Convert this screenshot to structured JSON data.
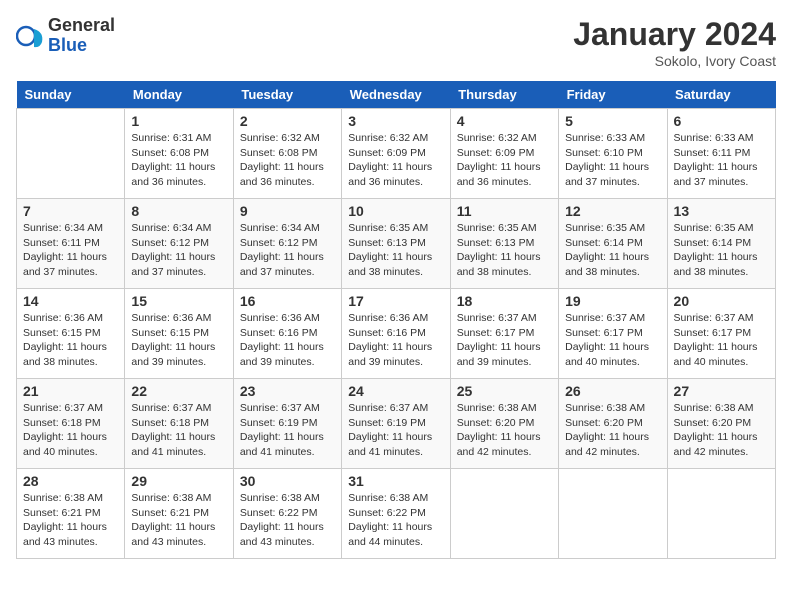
{
  "logo": {
    "general": "General",
    "blue": "Blue"
  },
  "title": "January 2024",
  "subtitle": "Sokolo, Ivory Coast",
  "days_of_week": [
    "Sunday",
    "Monday",
    "Tuesday",
    "Wednesday",
    "Thursday",
    "Friday",
    "Saturday"
  ],
  "weeks": [
    [
      {
        "day": "",
        "content": ""
      },
      {
        "day": "1",
        "content": "Sunrise: 6:31 AM\nSunset: 6:08 PM\nDaylight: 11 hours and 36 minutes."
      },
      {
        "day": "2",
        "content": "Sunrise: 6:32 AM\nSunset: 6:08 PM\nDaylight: 11 hours and 36 minutes."
      },
      {
        "day": "3",
        "content": "Sunrise: 6:32 AM\nSunset: 6:09 PM\nDaylight: 11 hours and 36 minutes."
      },
      {
        "day": "4",
        "content": "Sunrise: 6:32 AM\nSunset: 6:09 PM\nDaylight: 11 hours and 36 minutes."
      },
      {
        "day": "5",
        "content": "Sunrise: 6:33 AM\nSunset: 6:10 PM\nDaylight: 11 hours and 37 minutes."
      },
      {
        "day": "6",
        "content": "Sunrise: 6:33 AM\nSunset: 6:11 PM\nDaylight: 11 hours and 37 minutes."
      }
    ],
    [
      {
        "day": "7",
        "content": "Sunrise: 6:34 AM\nSunset: 6:11 PM\nDaylight: 11 hours and 37 minutes."
      },
      {
        "day": "8",
        "content": "Sunrise: 6:34 AM\nSunset: 6:12 PM\nDaylight: 11 hours and 37 minutes."
      },
      {
        "day": "9",
        "content": "Sunrise: 6:34 AM\nSunset: 6:12 PM\nDaylight: 11 hours and 37 minutes."
      },
      {
        "day": "10",
        "content": "Sunrise: 6:35 AM\nSunset: 6:13 PM\nDaylight: 11 hours and 38 minutes."
      },
      {
        "day": "11",
        "content": "Sunrise: 6:35 AM\nSunset: 6:13 PM\nDaylight: 11 hours and 38 minutes."
      },
      {
        "day": "12",
        "content": "Sunrise: 6:35 AM\nSunset: 6:14 PM\nDaylight: 11 hours and 38 minutes."
      },
      {
        "day": "13",
        "content": "Sunrise: 6:35 AM\nSunset: 6:14 PM\nDaylight: 11 hours and 38 minutes."
      }
    ],
    [
      {
        "day": "14",
        "content": "Sunrise: 6:36 AM\nSunset: 6:15 PM\nDaylight: 11 hours and 38 minutes."
      },
      {
        "day": "15",
        "content": "Sunrise: 6:36 AM\nSunset: 6:15 PM\nDaylight: 11 hours and 39 minutes."
      },
      {
        "day": "16",
        "content": "Sunrise: 6:36 AM\nSunset: 6:16 PM\nDaylight: 11 hours and 39 minutes."
      },
      {
        "day": "17",
        "content": "Sunrise: 6:36 AM\nSunset: 6:16 PM\nDaylight: 11 hours and 39 minutes."
      },
      {
        "day": "18",
        "content": "Sunrise: 6:37 AM\nSunset: 6:17 PM\nDaylight: 11 hours and 39 minutes."
      },
      {
        "day": "19",
        "content": "Sunrise: 6:37 AM\nSunset: 6:17 PM\nDaylight: 11 hours and 40 minutes."
      },
      {
        "day": "20",
        "content": "Sunrise: 6:37 AM\nSunset: 6:17 PM\nDaylight: 11 hours and 40 minutes."
      }
    ],
    [
      {
        "day": "21",
        "content": "Sunrise: 6:37 AM\nSunset: 6:18 PM\nDaylight: 11 hours and 40 minutes."
      },
      {
        "day": "22",
        "content": "Sunrise: 6:37 AM\nSunset: 6:18 PM\nDaylight: 11 hours and 41 minutes."
      },
      {
        "day": "23",
        "content": "Sunrise: 6:37 AM\nSunset: 6:19 PM\nDaylight: 11 hours and 41 minutes."
      },
      {
        "day": "24",
        "content": "Sunrise: 6:37 AM\nSunset: 6:19 PM\nDaylight: 11 hours and 41 minutes."
      },
      {
        "day": "25",
        "content": "Sunrise: 6:38 AM\nSunset: 6:20 PM\nDaylight: 11 hours and 42 minutes."
      },
      {
        "day": "26",
        "content": "Sunrise: 6:38 AM\nSunset: 6:20 PM\nDaylight: 11 hours and 42 minutes."
      },
      {
        "day": "27",
        "content": "Sunrise: 6:38 AM\nSunset: 6:20 PM\nDaylight: 11 hours and 42 minutes."
      }
    ],
    [
      {
        "day": "28",
        "content": "Sunrise: 6:38 AM\nSunset: 6:21 PM\nDaylight: 11 hours and 43 minutes."
      },
      {
        "day": "29",
        "content": "Sunrise: 6:38 AM\nSunset: 6:21 PM\nDaylight: 11 hours and 43 minutes."
      },
      {
        "day": "30",
        "content": "Sunrise: 6:38 AM\nSunset: 6:22 PM\nDaylight: 11 hours and 43 minutes."
      },
      {
        "day": "31",
        "content": "Sunrise: 6:38 AM\nSunset: 6:22 PM\nDaylight: 11 hours and 44 minutes."
      },
      {
        "day": "",
        "content": ""
      },
      {
        "day": "",
        "content": ""
      },
      {
        "day": "",
        "content": ""
      }
    ]
  ]
}
